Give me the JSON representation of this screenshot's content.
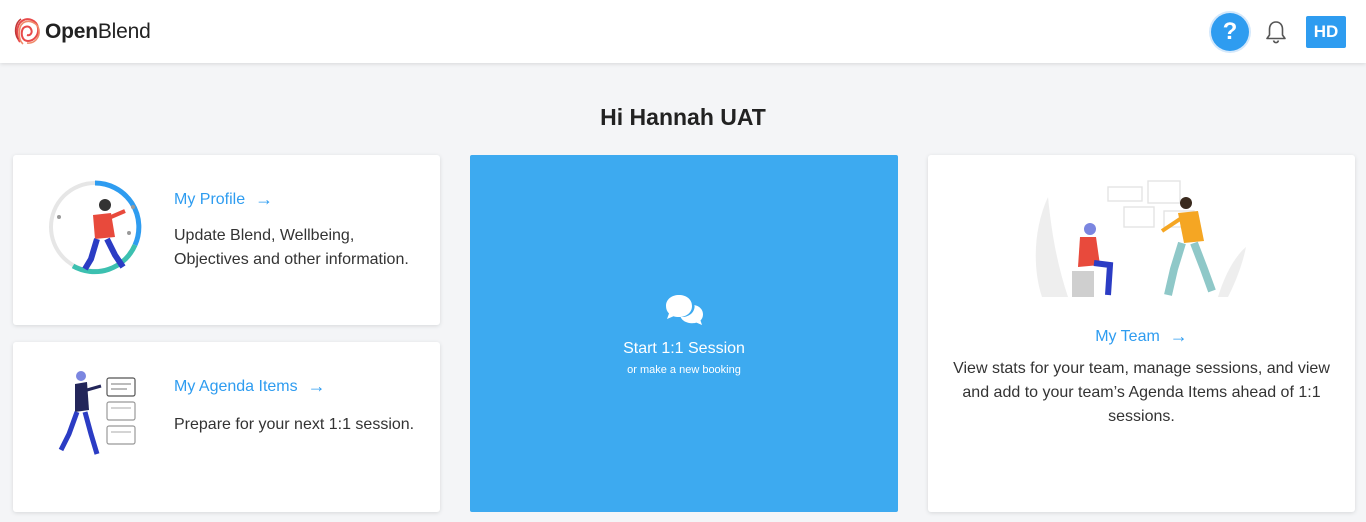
{
  "app": {
    "brand_name_bold": "Open",
    "brand_name_light": "Blend"
  },
  "header": {
    "help_label": "?",
    "avatar_initials": "HD",
    "help_icon": "question-icon",
    "bell_icon": "bell-icon"
  },
  "greeting": "Hi Hannah UAT",
  "cards": {
    "profile": {
      "title": "My Profile",
      "arrow": "→",
      "description": "Update Blend, Wellbeing, Objectives and other information."
    },
    "agenda": {
      "title": "My Agenda Items",
      "arrow": "→",
      "description": "Prepare for your next 1:1 session."
    },
    "session": {
      "title": "Start 1:1 Session",
      "subtitle": "or make a new booking",
      "icon": "chat-bubbles-icon"
    },
    "team": {
      "title": "My Team",
      "arrow": "→",
      "description": "View stats for your team, manage sessions, and view and add to your team’s Agenda Items ahead of 1:1 sessions."
    }
  },
  "colors": {
    "accent": "#2e9cf0",
    "session_card": "#3daaf0",
    "background": "#f4f5f7"
  }
}
